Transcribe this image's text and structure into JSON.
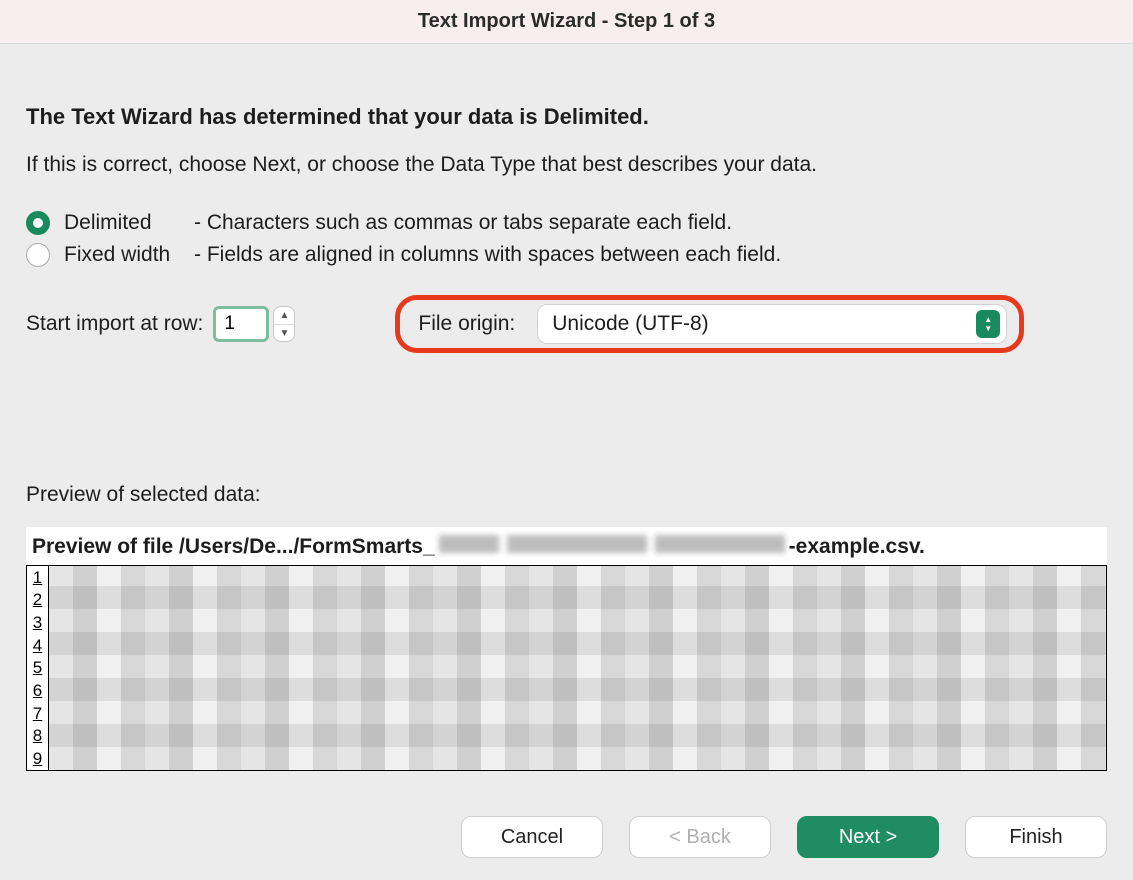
{
  "title": "Text Import Wizard - Step 1 of 3",
  "heading": "The Text Wizard has determined that your data is Delimited.",
  "subtext": "If this is correct, choose Next, or choose the Data Type that best describes your data.",
  "options": {
    "delimited": {
      "label": "Delimited",
      "desc": "- Characters such as commas or tabs separate each field."
    },
    "fixed": {
      "label": "Fixed width",
      "desc": "- Fields are aligned in columns with spaces between each field."
    }
  },
  "start_row": {
    "label": "Start import at row:",
    "value": "1"
  },
  "file_origin": {
    "label": "File origin:",
    "value": "Unicode (UTF-8)"
  },
  "preview": {
    "label": "Preview of selected data:",
    "file_prefix": "Preview of file /Users/De.../FormSmarts_",
    "file_suffix": "-example.csv.",
    "rows": [
      "1",
      "2",
      "3",
      "4",
      "5",
      "6",
      "7",
      "8",
      "9"
    ]
  },
  "buttons": {
    "cancel": "Cancel",
    "back": "< Back",
    "next": "Next >",
    "finish": "Finish"
  }
}
